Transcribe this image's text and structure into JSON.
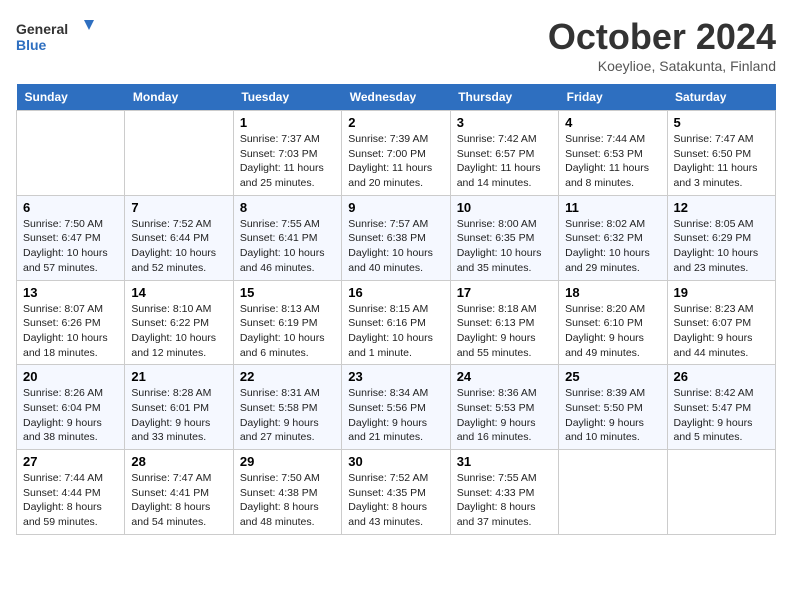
{
  "header": {
    "title": "October 2024",
    "location": "Koeylioe, Satakunta, Finland",
    "logo_line1": "General",
    "logo_line2": "Blue"
  },
  "days_of_week": [
    "Sunday",
    "Monday",
    "Tuesday",
    "Wednesday",
    "Thursday",
    "Friday",
    "Saturday"
  ],
  "weeks": [
    [
      {
        "day": "",
        "content": ""
      },
      {
        "day": "",
        "content": ""
      },
      {
        "day": "1",
        "content": "Sunrise: 7:37 AM\nSunset: 7:03 PM\nDaylight: 11 hours and 25 minutes."
      },
      {
        "day": "2",
        "content": "Sunrise: 7:39 AM\nSunset: 7:00 PM\nDaylight: 11 hours and 20 minutes."
      },
      {
        "day": "3",
        "content": "Sunrise: 7:42 AM\nSunset: 6:57 PM\nDaylight: 11 hours and 14 minutes."
      },
      {
        "day": "4",
        "content": "Sunrise: 7:44 AM\nSunset: 6:53 PM\nDaylight: 11 hours and 8 minutes."
      },
      {
        "day": "5",
        "content": "Sunrise: 7:47 AM\nSunset: 6:50 PM\nDaylight: 11 hours and 3 minutes."
      }
    ],
    [
      {
        "day": "6",
        "content": "Sunrise: 7:50 AM\nSunset: 6:47 PM\nDaylight: 10 hours and 57 minutes."
      },
      {
        "day": "7",
        "content": "Sunrise: 7:52 AM\nSunset: 6:44 PM\nDaylight: 10 hours and 52 minutes."
      },
      {
        "day": "8",
        "content": "Sunrise: 7:55 AM\nSunset: 6:41 PM\nDaylight: 10 hours and 46 minutes."
      },
      {
        "day": "9",
        "content": "Sunrise: 7:57 AM\nSunset: 6:38 PM\nDaylight: 10 hours and 40 minutes."
      },
      {
        "day": "10",
        "content": "Sunrise: 8:00 AM\nSunset: 6:35 PM\nDaylight: 10 hours and 35 minutes."
      },
      {
        "day": "11",
        "content": "Sunrise: 8:02 AM\nSunset: 6:32 PM\nDaylight: 10 hours and 29 minutes."
      },
      {
        "day": "12",
        "content": "Sunrise: 8:05 AM\nSunset: 6:29 PM\nDaylight: 10 hours and 23 minutes."
      }
    ],
    [
      {
        "day": "13",
        "content": "Sunrise: 8:07 AM\nSunset: 6:26 PM\nDaylight: 10 hours and 18 minutes."
      },
      {
        "day": "14",
        "content": "Sunrise: 8:10 AM\nSunset: 6:22 PM\nDaylight: 10 hours and 12 minutes."
      },
      {
        "day": "15",
        "content": "Sunrise: 8:13 AM\nSunset: 6:19 PM\nDaylight: 10 hours and 6 minutes."
      },
      {
        "day": "16",
        "content": "Sunrise: 8:15 AM\nSunset: 6:16 PM\nDaylight: 10 hours and 1 minute."
      },
      {
        "day": "17",
        "content": "Sunrise: 8:18 AM\nSunset: 6:13 PM\nDaylight: 9 hours and 55 minutes."
      },
      {
        "day": "18",
        "content": "Sunrise: 8:20 AM\nSunset: 6:10 PM\nDaylight: 9 hours and 49 minutes."
      },
      {
        "day": "19",
        "content": "Sunrise: 8:23 AM\nSunset: 6:07 PM\nDaylight: 9 hours and 44 minutes."
      }
    ],
    [
      {
        "day": "20",
        "content": "Sunrise: 8:26 AM\nSunset: 6:04 PM\nDaylight: 9 hours and 38 minutes."
      },
      {
        "day": "21",
        "content": "Sunrise: 8:28 AM\nSunset: 6:01 PM\nDaylight: 9 hours and 33 minutes."
      },
      {
        "day": "22",
        "content": "Sunrise: 8:31 AM\nSunset: 5:58 PM\nDaylight: 9 hours and 27 minutes."
      },
      {
        "day": "23",
        "content": "Sunrise: 8:34 AM\nSunset: 5:56 PM\nDaylight: 9 hours and 21 minutes."
      },
      {
        "day": "24",
        "content": "Sunrise: 8:36 AM\nSunset: 5:53 PM\nDaylight: 9 hours and 16 minutes."
      },
      {
        "day": "25",
        "content": "Sunrise: 8:39 AM\nSunset: 5:50 PM\nDaylight: 9 hours and 10 minutes."
      },
      {
        "day": "26",
        "content": "Sunrise: 8:42 AM\nSunset: 5:47 PM\nDaylight: 9 hours and 5 minutes."
      }
    ],
    [
      {
        "day": "27",
        "content": "Sunrise: 7:44 AM\nSunset: 4:44 PM\nDaylight: 8 hours and 59 minutes."
      },
      {
        "day": "28",
        "content": "Sunrise: 7:47 AM\nSunset: 4:41 PM\nDaylight: 8 hours and 54 minutes."
      },
      {
        "day": "29",
        "content": "Sunrise: 7:50 AM\nSunset: 4:38 PM\nDaylight: 8 hours and 48 minutes."
      },
      {
        "day": "30",
        "content": "Sunrise: 7:52 AM\nSunset: 4:35 PM\nDaylight: 8 hours and 43 minutes."
      },
      {
        "day": "31",
        "content": "Sunrise: 7:55 AM\nSunset: 4:33 PM\nDaylight: 8 hours and 37 minutes."
      },
      {
        "day": "",
        "content": ""
      },
      {
        "day": "",
        "content": ""
      }
    ]
  ]
}
